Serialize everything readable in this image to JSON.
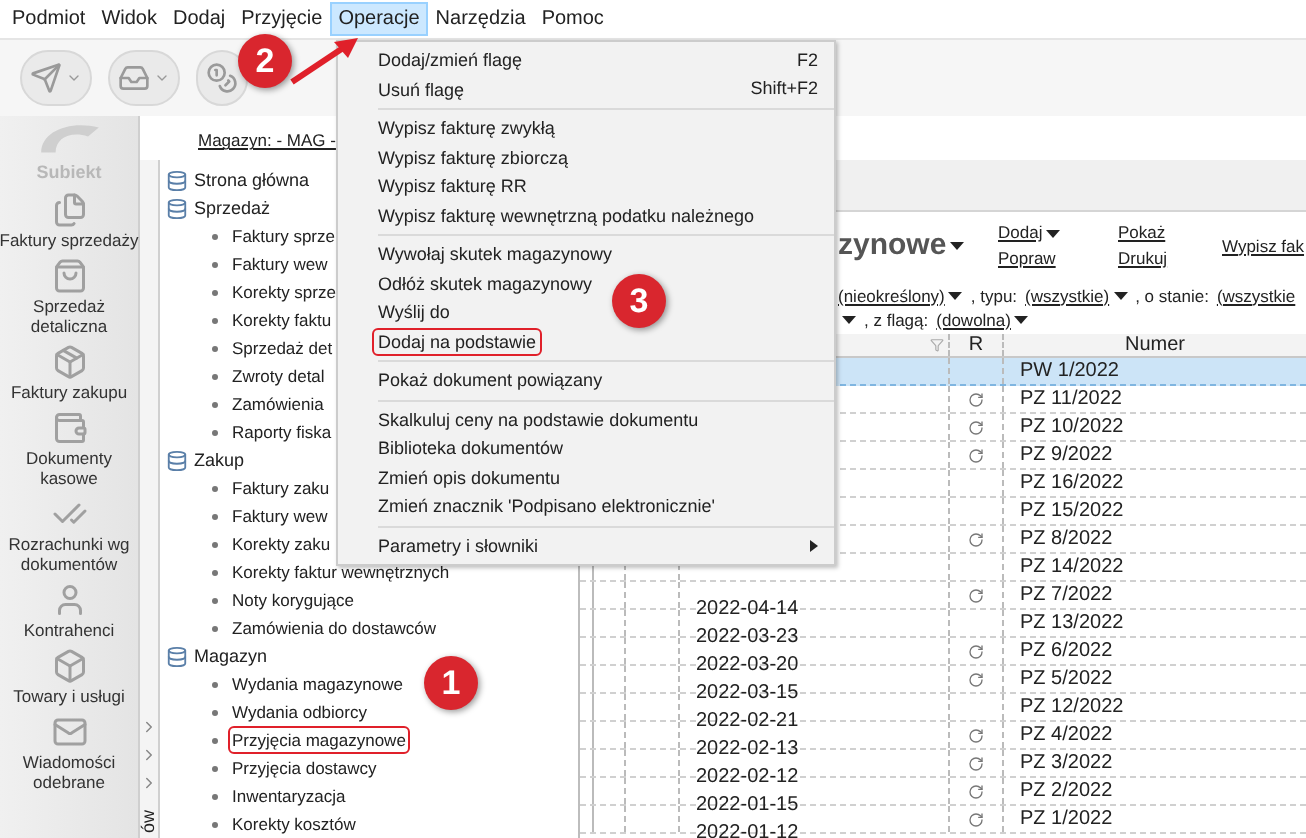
{
  "menu_bar": [
    {
      "label": "Podmiot",
      "selected": false
    },
    {
      "label": "Widok",
      "selected": false
    },
    {
      "label": "Dodaj",
      "selected": false
    },
    {
      "label": "Przyjęcie",
      "selected": false
    },
    {
      "label": "Operacje",
      "selected": true
    },
    {
      "label": "Narzędzia",
      "selected": false
    },
    {
      "label": "Pomoc",
      "selected": false
    }
  ],
  "logo": {
    "label": "Subiekt"
  },
  "sidebar": {
    "items": [
      {
        "label": "Faktury sprzedaży",
        "kind": "invoice"
      },
      {
        "label": "Sprzedaż detaliczna",
        "kind": "retail"
      },
      {
        "label": "Faktury zakupu",
        "kind": "purchase"
      },
      {
        "label": "Dokumenty kasowe",
        "kind": "cash"
      },
      {
        "label": "Rozrachunki wg dokumentów",
        "kind": "settlement"
      },
      {
        "label": "Kontrahenci",
        "kind": "person"
      },
      {
        "label": "Towary i usługi",
        "kind": "goods"
      },
      {
        "label": "Wiadomości odebrane",
        "kind": "mail"
      }
    ]
  },
  "side_strip": {
    "label": "ów"
  },
  "location": {
    "label": "Magazyn: - MAG -"
  },
  "tree": [
    {
      "label": "Strona główna"
    },
    {
      "label": "Sprzedaż",
      "children": [
        {
          "label": "Faktury sprze",
          "outlined": false
        },
        {
          "label": "Faktury wew",
          "outlined": false
        },
        {
          "label": "Korekty sprze",
          "outlined": false
        },
        {
          "label": "Korekty faktu",
          "outlined": false
        },
        {
          "label": "Sprzedaż det",
          "outlined": false
        },
        {
          "label": "Zwroty detal",
          "outlined": false
        },
        {
          "label": "Zamówienia",
          "outlined": false
        },
        {
          "label": "Raporty fiska",
          "outlined": false
        }
      ]
    },
    {
      "label": "Zakup",
      "children": [
        {
          "label": "Faktury zaku",
          "outlined": false
        },
        {
          "label": "Faktury wew",
          "outlined": false
        },
        {
          "label": "Korekty zaku",
          "outlined": false
        },
        {
          "label": "Korekty faktur wewnętrznych",
          "outlined": false
        },
        {
          "label": "Noty korygujące",
          "outlined": false
        },
        {
          "label": "Zamówienia do dostawców",
          "outlined": false
        }
      ]
    },
    {
      "label": "Magazyn",
      "children": [
        {
          "label": "Wydania magazynowe",
          "outlined": false
        },
        {
          "label": "Wydania odbiorcy",
          "outlined": false
        },
        {
          "label": "Przyjęcia magazynowe",
          "outlined": true
        },
        {
          "label": "Przyjęcia dostawcy",
          "outlined": false
        },
        {
          "label": "Inwentaryzacja",
          "outlined": false
        },
        {
          "label": "Korekty kosztów",
          "outlined": false
        }
      ]
    }
  ],
  "page": {
    "title": "zynowe",
    "actions": [
      [
        {
          "label": "Dodaj",
          "dropdown": true
        },
        {
          "label": "Popraw",
          "dropdown": false
        }
      ],
      [
        {
          "label": "Pokaż",
          "dropdown": false
        },
        {
          "label": "Drukuj",
          "dropdown": false
        }
      ],
      [
        {
          "label": "Wypisz fak",
          "dropdown": false
        }
      ]
    ],
    "filters": [
      [
        {
          "kind": "link",
          "text": "(nieokreślony)",
          "dropdown": true
        },
        {
          "kind": "label",
          "text": ", typu:"
        },
        {
          "kind": "link",
          "text": "(wszystkie)",
          "dropdown": true
        },
        {
          "kind": "label",
          "text": ", o stanie:"
        },
        {
          "kind": "link",
          "text": "(wszystkie",
          "dropdown": false
        }
      ],
      [
        {
          "kind": "caret"
        },
        {
          "kind": "label",
          "text": ", z flagą:"
        },
        {
          "kind": "link",
          "text": "(dowolna)",
          "dropdown": true
        }
      ]
    ]
  },
  "table": {
    "columns": [
      {
        "label": "R"
      },
      {
        "label": "Numer"
      }
    ],
    "rows": [
      {
        "number": "PW 1/2022",
        "r_mark": false,
        "selected": true
      },
      {
        "number": "PZ 11/2022",
        "r_mark": true,
        "selected": false
      },
      {
        "number": "PZ 10/2022",
        "r_mark": true,
        "selected": false
      },
      {
        "number": "PZ 9/2022",
        "r_mark": true,
        "selected": false
      },
      {
        "number": "PZ 16/2022",
        "r_mark": false,
        "selected": false
      },
      {
        "number": "PZ 15/2022",
        "r_mark": false,
        "selected": false
      },
      {
        "number": "PZ 8/2022",
        "r_mark": true,
        "selected": false
      },
      {
        "number": "PZ 14/2022",
        "r_mark": false,
        "selected": false
      },
      {
        "date": "2022-04-14",
        "number": "PZ 7/2022",
        "r_mark": true,
        "selected": false
      },
      {
        "date": "2022-03-23",
        "number": "PZ 13/2022",
        "r_mark": false,
        "selected": false
      },
      {
        "date": "2022-03-20",
        "number": "PZ 6/2022",
        "r_mark": true,
        "selected": false
      },
      {
        "date": "2022-03-15",
        "number": "PZ 5/2022",
        "r_mark": true,
        "selected": false
      },
      {
        "date": "2022-02-21",
        "number": "PZ 12/2022",
        "r_mark": false,
        "selected": false
      },
      {
        "date": "2022-02-13",
        "number": "PZ 4/2022",
        "r_mark": true,
        "selected": false
      },
      {
        "date": "2022-02-12",
        "number": "PZ 3/2022",
        "r_mark": true,
        "selected": false
      },
      {
        "date": "2022-01-15",
        "number": "PZ 2/2022",
        "r_mark": true,
        "selected": false
      },
      {
        "date": "2022-01-12",
        "number": "PZ 1/2022",
        "r_mark": true,
        "selected": false
      }
    ]
  },
  "menu": {
    "items": [
      {
        "kind": "item",
        "label": "Dodaj/zmień flagę",
        "shortcut": "F2",
        "outlined": false
      },
      {
        "kind": "item",
        "label": "Usuń flagę",
        "shortcut": "Shift+F2",
        "outlined": false
      },
      {
        "kind": "separator"
      },
      {
        "kind": "item",
        "label": "Wypisz fakturę zwykłą",
        "outlined": false
      },
      {
        "kind": "item",
        "label": "Wypisz fakturę zbiorczą",
        "outlined": false
      },
      {
        "kind": "item",
        "label": "Wypisz fakturę RR",
        "outlined": false
      },
      {
        "kind": "item",
        "label": "Wypisz fakturę wewnętrzną podatku należnego",
        "outlined": false
      },
      {
        "kind": "separator"
      },
      {
        "kind": "item",
        "label": "Wywołaj skutek magazynowy",
        "outlined": false
      },
      {
        "kind": "item",
        "label": "Odłóż skutek magazynowy",
        "outlined": false
      },
      {
        "kind": "item",
        "label": "Wyślij do",
        "outlined": false
      },
      {
        "kind": "item",
        "label": "Dodaj na podstawie",
        "outlined": true
      },
      {
        "kind": "separator"
      },
      {
        "kind": "item",
        "label": "Pokaż dokument powiązany",
        "outlined": false
      },
      {
        "kind": "separator"
      },
      {
        "kind": "item",
        "label": "Skalkuluj ceny na podstawie dokumentu",
        "outlined": false
      },
      {
        "kind": "item",
        "label": "Biblioteka dokumentów",
        "outlined": false
      },
      {
        "kind": "item",
        "label": "Zmień opis dokumentu",
        "outlined": false
      },
      {
        "kind": "item",
        "label": "Zmień znacznik 'Podpisano elektronicznie'",
        "outlined": false
      },
      {
        "kind": "separator"
      },
      {
        "kind": "submenu",
        "label": "Parametry i słowniki",
        "outlined": false
      }
    ]
  },
  "annotations": [
    {
      "number": "2"
    },
    {
      "number": "3"
    },
    {
      "number": "1"
    }
  ]
}
